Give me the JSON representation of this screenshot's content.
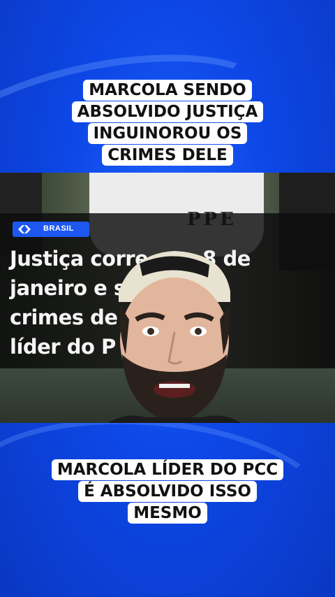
{
  "caption_top": {
    "lines": [
      "MARCOLA SENDO",
      "ABSOLVIDO JUSTIÇA",
      "INGUINOROU OS",
      "CRIMES DELE"
    ]
  },
  "caption_bottom": {
    "lines": [
      "MARCOLA LÍDER DO PCC",
      "É ABSOLVIDO ISSO",
      "MESMO"
    ]
  },
  "video": {
    "shirt_text": "PPE",
    "channel_label": "BRASIL",
    "headline": "Justiça corre    m o 8 de\njaneiro e            screver os\ncrimes de             principal\nlíder do P"
  },
  "colors": {
    "background": "#0d47e6",
    "caption_bg": "#ffffff",
    "caption_text": "#111111",
    "logo_blue": "#1d57f0"
  }
}
